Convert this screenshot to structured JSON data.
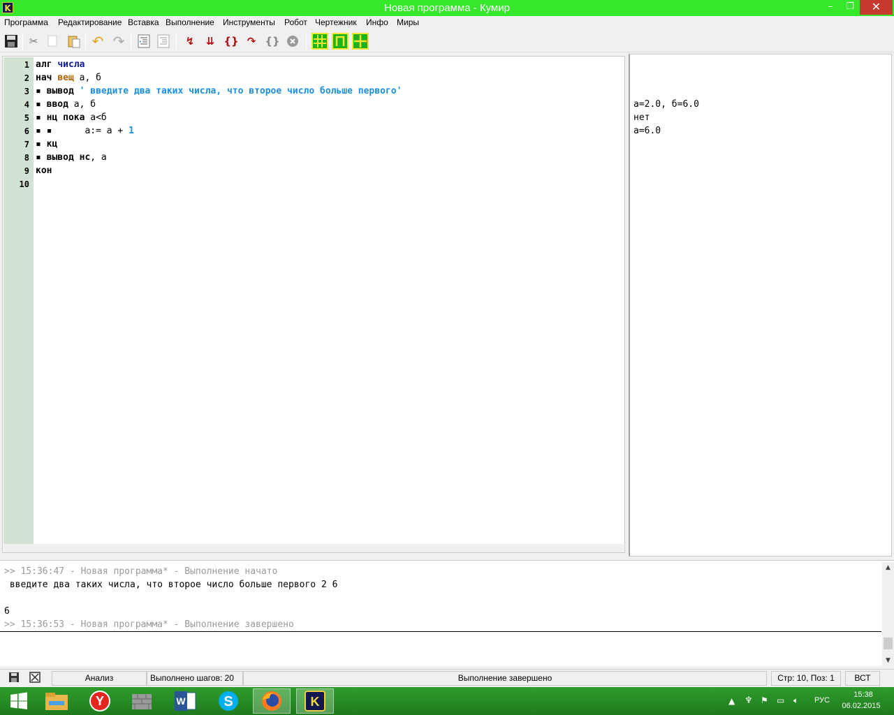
{
  "window": {
    "title": "Новая программа - Кумир",
    "app_icon_letter": "K",
    "controls": {
      "minimize": "–",
      "maximize": "❐",
      "close": "✕"
    }
  },
  "menu": [
    "Программа",
    "Редактирование",
    "Вставка",
    "Выполнение",
    "Инструменты",
    "Робот",
    "Чертежник",
    "Инфо",
    "Миры"
  ],
  "toolbar": {
    "icons": [
      "save-icon",
      "cut-icon",
      "copy-icon",
      "paste-icon",
      "undo-icon",
      "redo-icon",
      "indent-icon",
      "unindent-icon",
      "run-icon",
      "run-step-icon",
      "step-into-icon",
      "step-over-icon",
      "step-out-icon",
      "stop-icon",
      "robot-world-icon",
      "draftsman-icon",
      "grid-world-icon"
    ]
  },
  "editor": {
    "line_numbers": [
      "1",
      "2",
      "3",
      "4",
      "5",
      "6",
      "7",
      "8",
      "9",
      "10"
    ],
    "lines": [
      {
        "tokens": [
          {
            "t": "алг ",
            "c": "kw"
          },
          {
            "t": "числа",
            "c": "nm"
          }
        ]
      },
      {
        "tokens": [
          {
            "t": "нач ",
            "c": "kw"
          },
          {
            "t": "вещ",
            "c": "ty"
          },
          {
            "t": " а, б",
            "c": ""
          }
        ]
      },
      {
        "tokens": [
          {
            "t": "▪ ",
            "c": "dot"
          },
          {
            "t": "вывод",
            "c": "kw"
          },
          {
            "t": " ' введите два таких числа, что второе число больше первого'",
            "c": "st"
          }
        ]
      },
      {
        "tokens": [
          {
            "t": "▪ ",
            "c": "dot"
          },
          {
            "t": "ввод",
            "c": "kw"
          },
          {
            "t": " а, б",
            "c": ""
          }
        ]
      },
      {
        "tokens": [
          {
            "t": "▪ ",
            "c": "dot"
          },
          {
            "t": "нц пока",
            "c": "kw"
          },
          {
            "t": " а<б",
            "c": ""
          }
        ]
      },
      {
        "tokens": [
          {
            "t": "▪ ▪      ",
            "c": "dot"
          },
          {
            "t": "а:= а + ",
            "c": ""
          },
          {
            "t": "1",
            "c": "num"
          }
        ]
      },
      {
        "tokens": [
          {
            "t": "▪ ",
            "c": "dot"
          },
          {
            "t": "кц",
            "c": "kw"
          }
        ]
      },
      {
        "tokens": [
          {
            "t": "▪ ",
            "c": "dot"
          },
          {
            "t": "вывод нс",
            "c": "kw"
          },
          {
            "t": ", а",
            "c": ""
          }
        ]
      },
      {
        "tokens": [
          {
            "t": "кон",
            "c": "kw"
          }
        ]
      },
      {
        "tokens": []
      }
    ]
  },
  "right_pane": {
    "lines": [
      "а=2.0, б=6.0",
      "нет",
      "а=6.0"
    ]
  },
  "console": {
    "start_line": ">> 15:36:47 - Новая программа* - Выполнение начато",
    "output_line1": " введите два таких числа, что второе число больше первого 2 6",
    "output_line2": "",
    "output_line3": "6",
    "end_line": ">> 15:36:53 - Новая программа* - Выполнение завершено"
  },
  "statusbar": {
    "analysis": "Анализ",
    "steps": "Выполнено шагов: 20",
    "status": "Выполнение завершено",
    "position": "Стр: 10, Поз: 1",
    "mode": "ВСТ"
  },
  "taskbar": {
    "apps": [
      "windows-start",
      "file-explorer",
      "yandex-browser",
      "wall-app",
      "word",
      "skype",
      "firefox",
      "kumir"
    ],
    "tray_lang": "РУС",
    "time": "15:38",
    "date": "06.02.2015"
  }
}
